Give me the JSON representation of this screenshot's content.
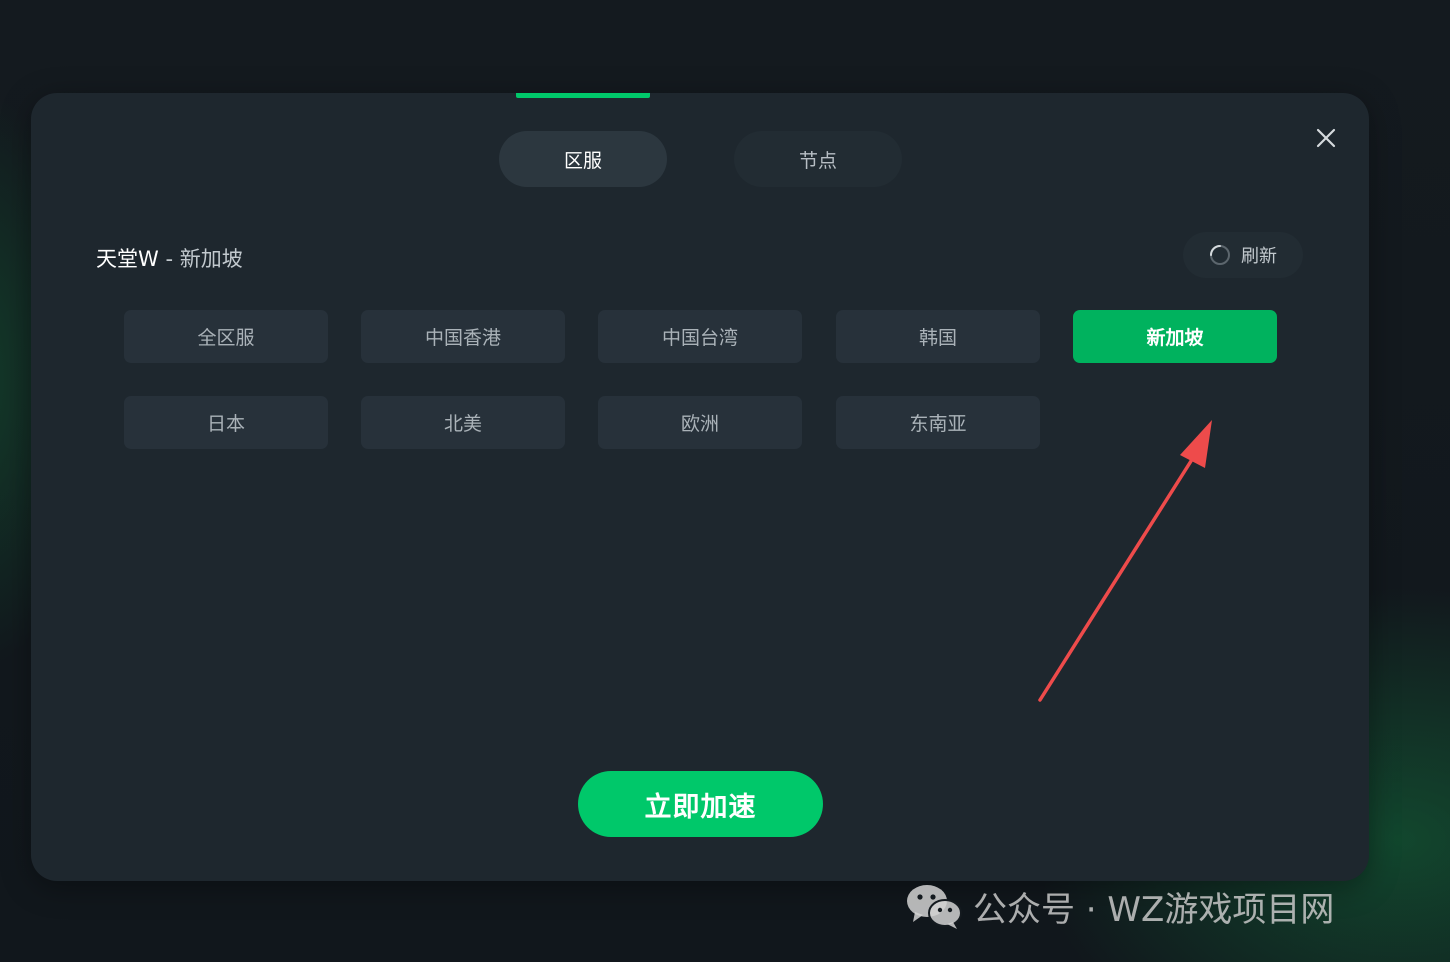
{
  "colors": {
    "accent": "#00c86a",
    "selected_chip": "#00b25e",
    "panel": "#1e272e",
    "arrow": "#ee4b4b"
  },
  "tabs": [
    {
      "label": "区服",
      "active": true
    },
    {
      "label": "节点",
      "active": false
    }
  ],
  "heading": {
    "game": "天堂W",
    "separator": " - ",
    "region": "新加坡"
  },
  "refresh": {
    "icon": "loading-spinner-icon",
    "label": "刷新"
  },
  "close": {
    "icon": "close-icon"
  },
  "regions": [
    {
      "label": "全区服",
      "selected": false
    },
    {
      "label": "中国香港",
      "selected": false
    },
    {
      "label": "中国台湾",
      "selected": false
    },
    {
      "label": "韩国",
      "selected": false
    },
    {
      "label": "新加坡",
      "selected": true
    },
    {
      "label": "日本",
      "selected": false
    },
    {
      "label": "北美",
      "selected": false
    },
    {
      "label": "欧洲",
      "selected": false
    },
    {
      "label": "东南亚",
      "selected": false
    }
  ],
  "primary_button": {
    "label": "立即加速"
  },
  "annotation": {
    "icon": "red-arrow-icon"
  },
  "watermark": {
    "icon": "wechat-icon",
    "text": "公众号 · WZ游戏项目网"
  }
}
